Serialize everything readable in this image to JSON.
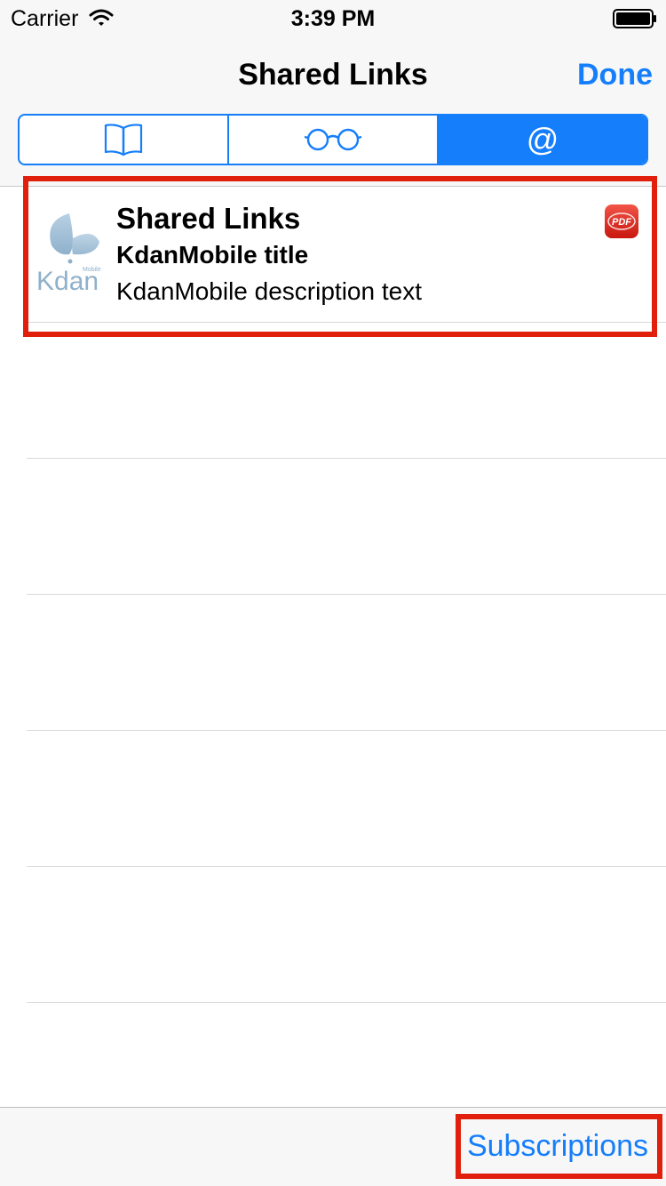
{
  "status_bar": {
    "carrier": "Carrier",
    "time": "3:39 PM"
  },
  "nav": {
    "title": "Shared Links",
    "done_label": "Done"
  },
  "segments": [
    {
      "icon": "book-icon",
      "selected": false
    },
    {
      "icon": "glasses-icon",
      "selected": false
    },
    {
      "icon": "at-icon",
      "label": "@",
      "selected": true
    }
  ],
  "list": {
    "items": [
      {
        "title": "Shared Links",
        "subtitle": "KdanMobile title",
        "description": "KdanMobile description text",
        "thumbnail_logo": "Kdan",
        "thumbnail_logo_small": "Mobile",
        "badge": "PDF"
      }
    ]
  },
  "toolbar": {
    "subscriptions_label": "Subscriptions"
  },
  "colors": {
    "accent": "#157efb",
    "annotation": "#e0200c",
    "pdf_badge": "#e52d27"
  }
}
